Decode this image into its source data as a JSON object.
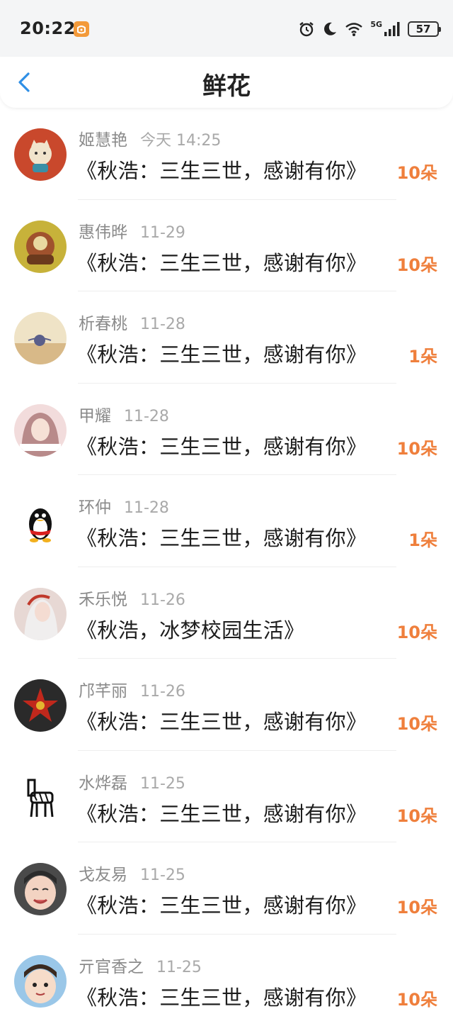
{
  "status_bar": {
    "time": "20:22",
    "network": "5G",
    "battery": "57",
    "icons": [
      "app-notification-icon",
      "alarm-icon",
      "moon-icon",
      "wifi-icon",
      "signal-icon",
      "battery-icon"
    ]
  },
  "header": {
    "title": "鲜花",
    "back_icon": "chevron-left-icon"
  },
  "colors": {
    "accent_orange": "#ef7f3c",
    "back_blue": "#2f8fe6",
    "name_gray": "#8a8a8a"
  },
  "items": [
    {
      "name": "姬慧艳",
      "date": "今天 14:25",
      "title": "《秋浩：三生三世，感谢有你》",
      "count": "10朵"
    },
    {
      "name": "惠伟晔",
      "date": "11-29",
      "title": "《秋浩：三生三世，感谢有你》",
      "count": "10朵"
    },
    {
      "name": "析春桃",
      "date": "11-28",
      "title": "《秋浩：三生三世，感谢有你》",
      "count": "1朵"
    },
    {
      "name": "甲耀",
      "date": "11-28",
      "title": "《秋浩：三生三世，感谢有你》",
      "count": "10朵"
    },
    {
      "name": "环仲",
      "date": "11-28",
      "title": "《秋浩：三生三世，感谢有你》",
      "count": "1朵"
    },
    {
      "name": "禾乐悦",
      "date": "11-26",
      "title": "《秋浩，冰梦校园生活》",
      "count": "10朵"
    },
    {
      "name": "邝芊丽",
      "date": "11-26",
      "title": "《秋浩：三生三世，感谢有你》",
      "count": "10朵"
    },
    {
      "name": "水烨磊",
      "date": "11-25",
      "title": "《秋浩：三生三世，感谢有你》",
      "count": "10朵"
    },
    {
      "name": "戈友易",
      "date": "11-25",
      "title": "《秋浩：三生三世，感谢有你》",
      "count": "10朵"
    },
    {
      "name": "亓官香之",
      "date": "11-25",
      "title": "《秋浩：三生三世，感谢有你》",
      "count": "10朵"
    }
  ]
}
